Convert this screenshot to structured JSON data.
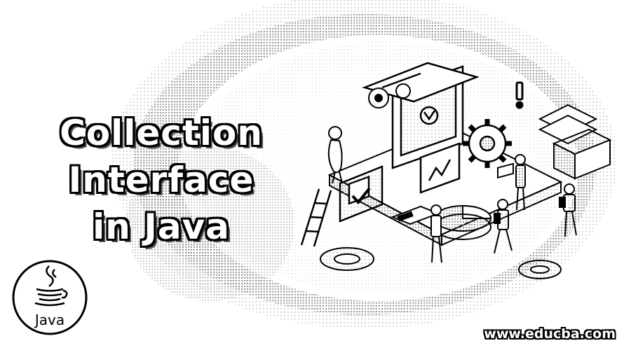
{
  "title": {
    "line1": "Collection",
    "line2": "Interface",
    "line3": "in Java"
  },
  "logo": {
    "label": "Java",
    "icon": "java-coffee-cup-icon"
  },
  "footer": {
    "url": "www.educba.com"
  },
  "illustration": {
    "icons": [
      "gear-icon",
      "checkmark-icon",
      "warning-icon",
      "ladder-icon",
      "pie-chart-icon",
      "laptop-icon",
      "people-icons"
    ]
  },
  "colors": {
    "background": "#ffffff",
    "ink": "#000000",
    "halftone": "#7a7a7a"
  }
}
